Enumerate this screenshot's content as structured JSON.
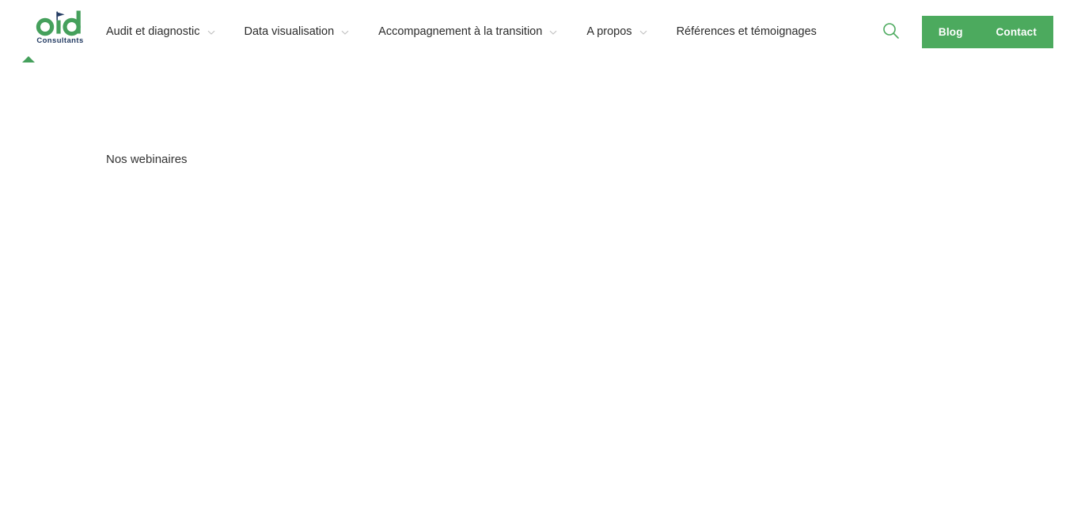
{
  "header": {
    "logo": {
      "wordmark": "oid",
      "subtitle": "Consultants",
      "mark_color": "#45a05c",
      "accent_color": "#243c63"
    },
    "nav": [
      {
        "label": "Audit et diagnostic",
        "has_dropdown": true,
        "icon": "chevron-down-icon"
      },
      {
        "label": "Data visualisation",
        "has_dropdown": true,
        "icon": "chevron-down-icon"
      },
      {
        "label": "Accompagnement à la transition",
        "has_dropdown": true,
        "icon": "chevron-down-icon"
      },
      {
        "label": "A propos",
        "has_dropdown": true,
        "icon": "chevron-down-icon"
      },
      {
        "label": "Références et témoignages",
        "has_dropdown": false,
        "icon": ""
      }
    ],
    "search": {
      "icon": "search-icon",
      "color": "#4caa5e"
    },
    "cta": {
      "background": "#4caa5e",
      "blog_label": "Blog",
      "contact_label": "Contact"
    },
    "scroll_caret": {
      "icon": "triangle-up-icon",
      "color": "#45a05c"
    }
  },
  "main": {
    "heading": "Nos webinaires",
    "heading_color": "#333333",
    "background": "#ffffff"
  }
}
